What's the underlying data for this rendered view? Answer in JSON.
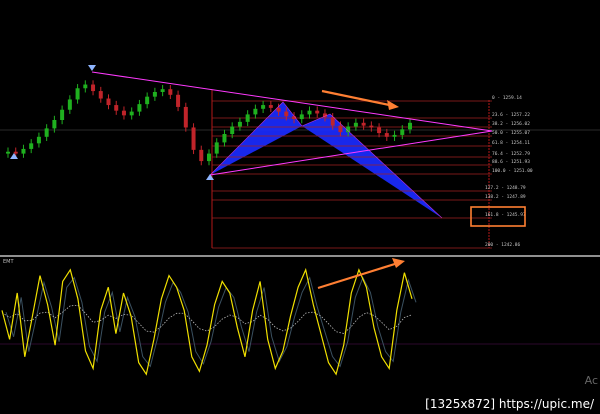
{
  "colors": {
    "background": "#000000",
    "bull_candle": "#1fb01f",
    "bear_candle": "#c0242a",
    "pattern_fill": "#1a2bff",
    "pattern_edge": "#ff3aff",
    "fib_line": "#a02020",
    "fib_vertical": "#e02020",
    "arrow_marker": "#8fb6ff",
    "annotation": "#ff7f33",
    "oscillator": "#f0e000",
    "oscillator_shadow": "#3a5060",
    "signal": "#b8b8b8"
  },
  "header_separator": "",
  "oscillator": {
    "title": "EMT"
  },
  "watermark": "[1325x872] https://upic.me/",
  "corner_text": "Ac",
  "chart_data": {
    "type": "line",
    "title": "",
    "fib_levels": [
      {
        "label": "0 - 1259.14"
      },
      {
        "label": "23.6 - 1257.22"
      },
      {
        "label": "38.2 - 1256.02"
      },
      {
        "label": "50.0 - 1255.07"
      },
      {
        "label": "61.8 - 1254.11"
      },
      {
        "label": "76.4 - 1252.79"
      },
      {
        "label": "88.6 - 1251.93"
      },
      {
        "label": "100.0 - 1251.00"
      },
      {
        "label": "127.2 - 1248.79"
      },
      {
        "label": "138.2 - 1247.89"
      },
      {
        "label": "161.8 - 1245.97"
      },
      {
        "label": "200 - 1242.86"
      }
    ],
    "highlighted_level": "161.8 - 1245.97",
    "price_series": [
      1252.6,
      1252.4,
      1252.9,
      1253.5,
      1254.2,
      1255.1,
      1256.0,
      1257.1,
      1258.2,
      1259.4,
      1259.8,
      1259.1,
      1258.3,
      1257.6,
      1257.0,
      1256.5,
      1256.9,
      1257.7,
      1258.5,
      1259.0,
      1259.3,
      1258.7,
      1257.4,
      1255.2,
      1252.8,
      1251.6,
      1252.4,
      1253.6,
      1254.5,
      1255.3,
      1255.8,
      1256.6,
      1257.2,
      1257.6,
      1257.3,
      1256.9,
      1256.4,
      1256.1,
      1256.6,
      1257.0,
      1256.7,
      1256.3,
      1255.4,
      1254.7,
      1255.3,
      1255.7,
      1255.4,
      1255.2,
      1254.6,
      1254.2,
      1254.4,
      1255.0,
      1255.7
    ],
    "oscillator_series": [
      0.2,
      -0.3,
      0.5,
      -0.6,
      0.1,
      0.8,
      0.3,
      -0.4,
      0.7,
      0.9,
      0.4,
      -0.5,
      -0.8,
      0.2,
      0.6,
      -0.2,
      0.5,
      0.1,
      -0.7,
      -0.9,
      -0.3,
      0.4,
      0.8,
      0.6,
      0.2,
      -0.6,
      -0.85,
      -0.4,
      0.3,
      0.7,
      0.5,
      -0.1,
      -0.6,
      0.2,
      0.7,
      -0.3,
      -0.8,
      -0.5,
      0.1,
      0.6,
      0.9,
      0.3,
      -0.2,
      -0.7,
      -0.9,
      -0.4,
      0.5,
      0.9,
      0.6,
      -0.1,
      -0.6,
      -0.8,
      0.2,
      0.85,
      0.4
    ],
    "xlabel": "",
    "ylabel": ""
  }
}
